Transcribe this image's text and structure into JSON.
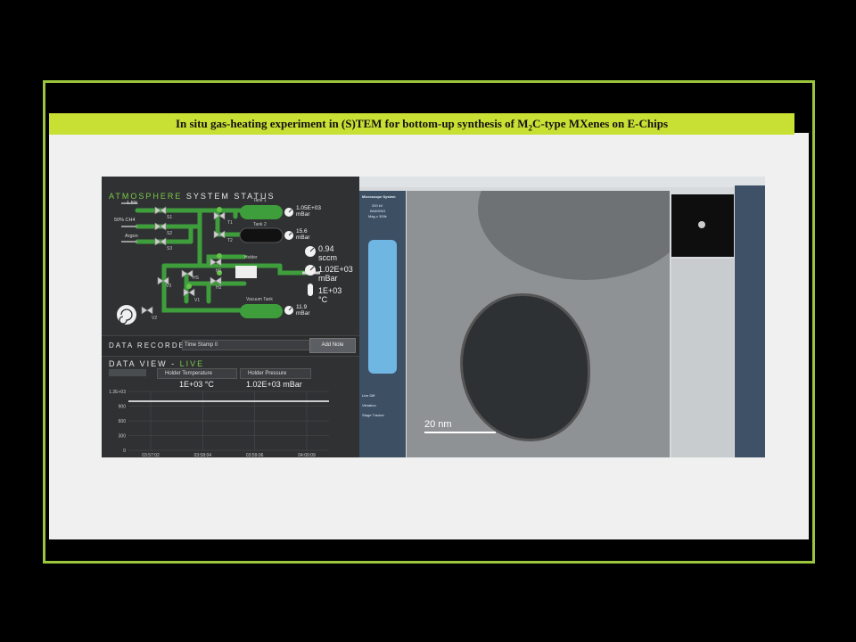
{
  "slide": {
    "title_pre": "In situ gas-heating experiment in (S)TEM for bottom-up synthesis of M",
    "title_sub": "2",
    "title_post": "C-type MXenes on E-Chips"
  },
  "atmosphere": {
    "title_a": "ATMOSPHERE",
    "title_b": " SYSTEM STATUS",
    "gases": [
      "1.5%",
      "50% CH4",
      "Argon"
    ],
    "valves": [
      "S1",
      "S2",
      "S3",
      "T1",
      "T2",
      "H1",
      "H2",
      "HS",
      "V3",
      "V1",
      "V2"
    ],
    "tank1_label": "Tank 1",
    "tank1_value": "1.05E+03",
    "tank1_unit": "mBar",
    "tank2_label": "Tank 2",
    "tank2_value": "15.6",
    "tank2_unit": "mBar",
    "flow_value": "0.94",
    "flow_unit": "sccm",
    "holder_label": "Holder",
    "holder_pressure": "1.02E+03",
    "holder_pressure_unit": "mBar",
    "holder_temp": "1E+03",
    "holder_temp_unit": "°C",
    "vacuum_label": "Vacuum Tank",
    "vacuum_value": "11.9",
    "vacuum_unit": "mBar"
  },
  "recorder": {
    "label": "DATA RECORDER",
    "timestamp": "Time Stamp 0",
    "add_note": "Add Note"
  },
  "dataview": {
    "title_a": "DATA VIEW - ",
    "title_b": "LIVE",
    "sel1": "Holder Temperature",
    "sel2": "Holder Pressure",
    "val1": "1E+03 °C",
    "val2": "1.02E+03 mBar",
    "y_ticks": [
      "1.2E+03",
      "900",
      "600",
      "300",
      "0"
    ],
    "x_ticks": [
      "03:57:02",
      "03:58:04",
      "03:59:06",
      "04:00:09"
    ]
  },
  "microscope": {
    "nav_header": "Microscope System",
    "items": [
      "200 kV",
      "IMAGING",
      "Mag x 300k"
    ],
    "bottom_items": [
      "Live Diff",
      "Vibration",
      "Stage Tracker"
    ],
    "scale": "20 nm"
  },
  "chart_data": {
    "type": "line",
    "title": "",
    "xlabel": "",
    "ylabel": "",
    "ylim": [
      0,
      1200
    ],
    "categories": [
      "03:57:02",
      "03:58:04",
      "03:59:06",
      "04:00:09"
    ],
    "series": [
      {
        "name": "Holder Temperature",
        "values": [
          1000,
          1000,
          1000,
          1000
        ]
      }
    ],
    "grid": true
  },
  "colors": {
    "accent_green": "#7ec94a",
    "banner": "#c8e033",
    "frame": "#9bc53d"
  }
}
